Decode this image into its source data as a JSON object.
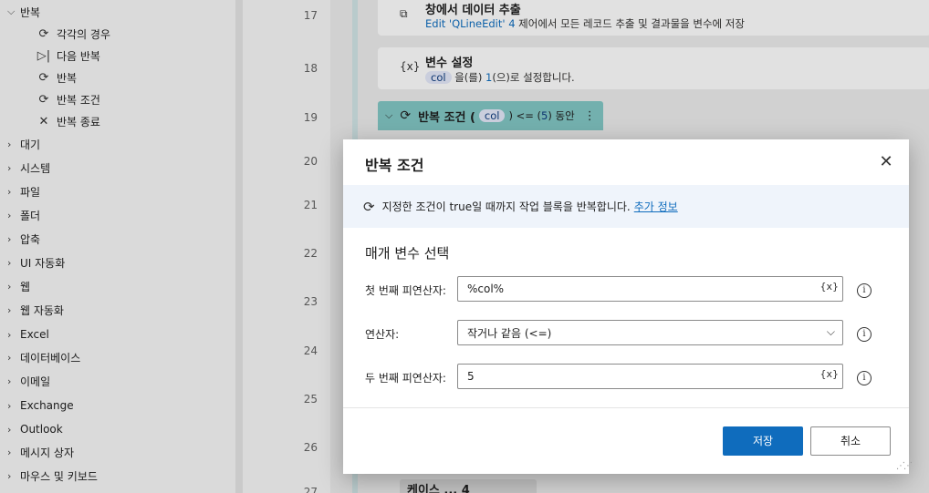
{
  "sidebar": {
    "group_loop": "반복",
    "loop_children": [
      {
        "icon": "loop-icon",
        "glyph": "⟳",
        "label": "각각의 경우"
      },
      {
        "icon": "next-loop-icon",
        "glyph": "▷|",
        "label": "다음 반복"
      },
      {
        "icon": "loop-icon",
        "glyph": "⟳",
        "label": "반복"
      },
      {
        "icon": "loop-icon",
        "glyph": "⟳",
        "label": "반복 조건"
      },
      {
        "icon": "close-icon",
        "glyph": "✕",
        "label": "반복 종료"
      }
    ],
    "groups": [
      "대기",
      "시스템",
      "파일",
      "폴더",
      "압축",
      "UI 자동화",
      "웹",
      "웹 자동화",
      "Excel",
      "데이터베이스",
      "이메일",
      "Exchange",
      "Outlook",
      "메시지 상자",
      "마우스 및 키보드"
    ]
  },
  "editor": {
    "line_numbers": [
      "17",
      "18",
      "19",
      "20",
      "21",
      "22",
      "23",
      "24",
      "25",
      "26",
      "27"
    ],
    "step17": {
      "title": "창에서 데이터 추출",
      "desc_link": "Edit 'QLineEdit' 4",
      "desc_rest": " 제어에서 모든 레코드 추출 및 결과물을 변수에 저장"
    },
    "step18": {
      "icon_glyph": "{x}",
      "title": "변수 설정",
      "var": "col",
      "desc_mid": " 을(를) ",
      "num": "1",
      "desc_rest": "(으)로 설정합니다."
    },
    "step19": {
      "title": "반복 조건 (",
      "var": "col",
      "op": ") <= (",
      "num": "5",
      "tail": ") 동안"
    },
    "bottom_step": "케이스 ... 4"
  },
  "dialog": {
    "title": "반복 조건",
    "info_text": "지정한 조건이 true일 때까지 작업 블록을 반복합니다.",
    "info_link": "추가 정보",
    "section_title": "매개 변수 선택",
    "fields": [
      {
        "label": "첫 번째 피연산자:",
        "value": "%col%",
        "var_button": "{x}"
      },
      {
        "label": "연산자:",
        "value": "작거나 같음 (<=)"
      },
      {
        "label": "두 번째 피연산자:",
        "value": "5",
        "var_button": "{x}"
      }
    ],
    "save_label": "저장",
    "cancel_label": "취소"
  },
  "colors": {
    "accent": "#0f6cbd",
    "loop_header": "#80c4c2",
    "info_band": "#eff4fb"
  }
}
